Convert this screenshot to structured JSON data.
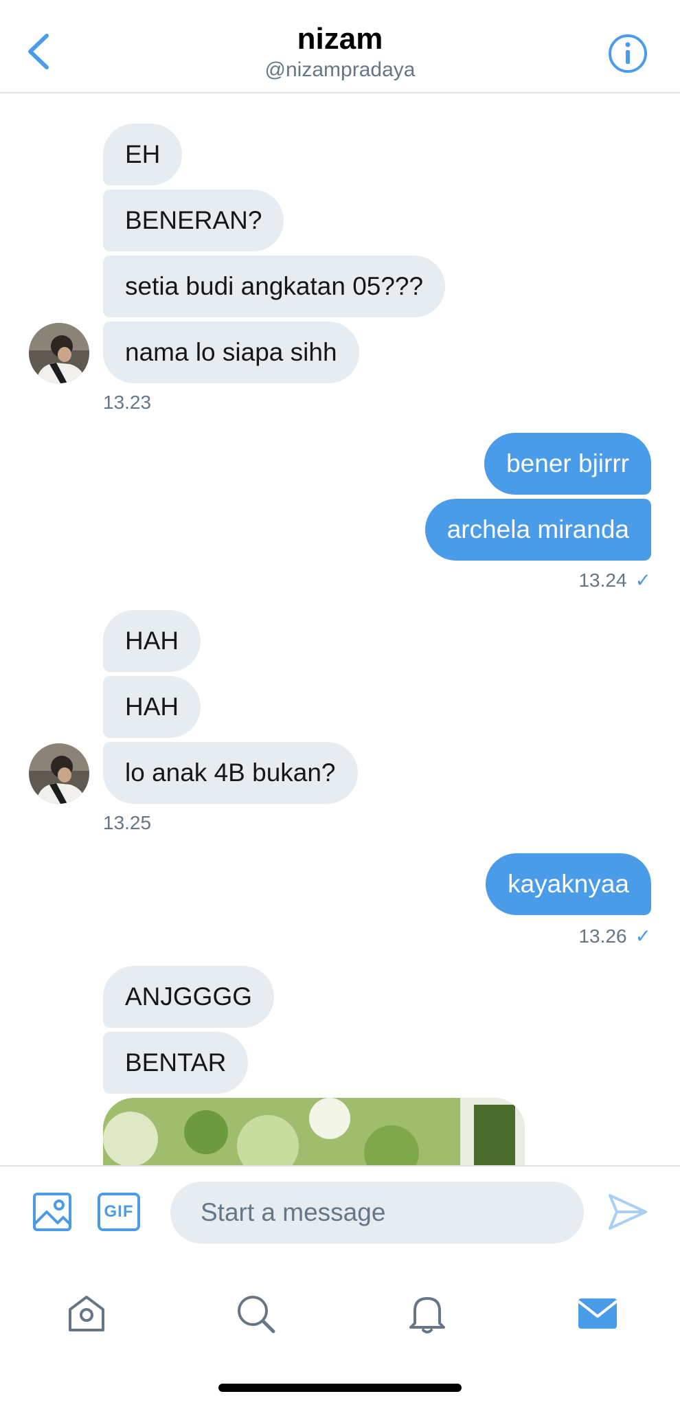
{
  "header": {
    "title": "nizam",
    "handle": "@nizampradaya"
  },
  "messages": {
    "group1": [
      "EH",
      "BENERAN?",
      "setia budi angkatan 05???",
      "nama lo siapa sihh"
    ],
    "group1_time": "13.23",
    "group2": [
      "bener bjirrr",
      "archela miranda"
    ],
    "group2_time": "13.24",
    "group3": [
      "HAH",
      "HAH",
      "lo anak 4B bukan?"
    ],
    "group3_time": "13.25",
    "group4": [
      "kayaknyaa"
    ],
    "group4_time": "13.26",
    "group5": [
      "ANJGGGG",
      "BENTAR"
    ]
  },
  "composer": {
    "gif_label": "GIF",
    "placeholder": "Start a message"
  },
  "colors": {
    "accent": "#4a9be8",
    "received_bubble": "#e6ecf0",
    "secondary_text": "#657786"
  },
  "icons": {
    "back": "chevron-left-icon",
    "info": "info-icon",
    "image": "image-icon",
    "send": "send-icon",
    "tabs": [
      "home-icon",
      "search-icon",
      "bell-icon",
      "mail-icon"
    ]
  }
}
